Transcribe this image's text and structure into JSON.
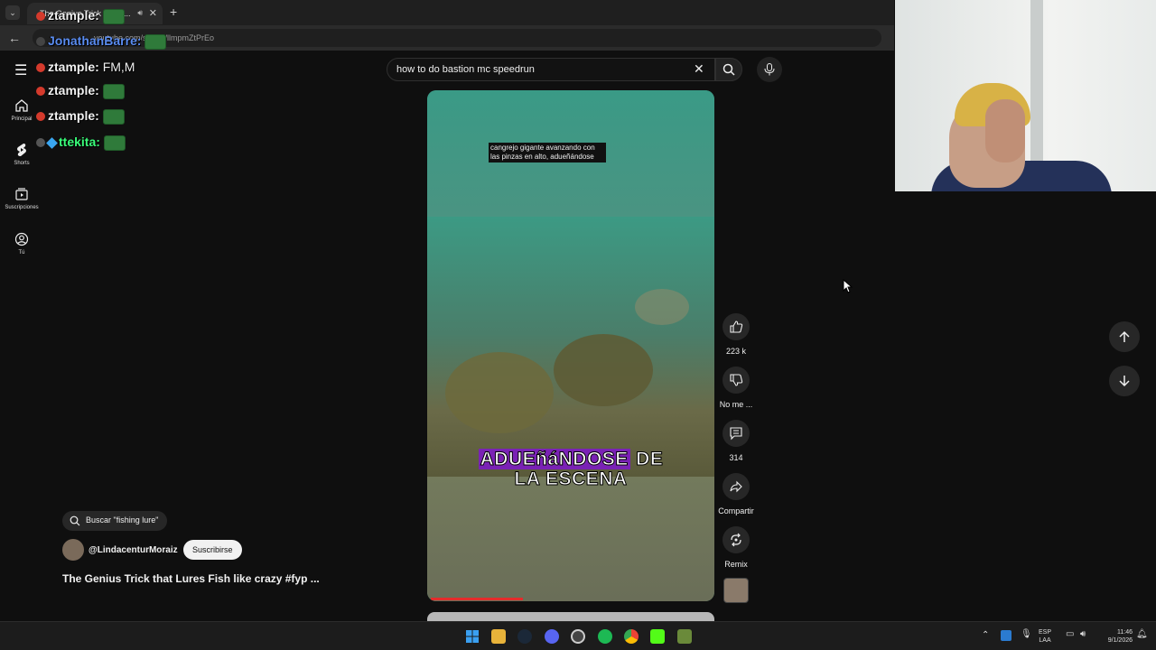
{
  "browser": {
    "tab_title": "The Genius Trick that L...",
    "url": "youtube.com/shorts/llmpmZtPrEo"
  },
  "search": {
    "query": "how to do bastion mc speedrun"
  },
  "sidebar": {
    "items": [
      {
        "label": "Principal",
        "icon": "home-icon"
      },
      {
        "label": "Shorts",
        "icon": "shorts-icon"
      },
      {
        "label": "Suscripciones",
        "icon": "subscriptions-icon"
      },
      {
        "label": "Tú",
        "icon": "account-icon"
      }
    ]
  },
  "chat": {
    "messages": [
      {
        "user": "ztample:",
        "color": "#f0f0f0",
        "text": ""
      },
      {
        "user": "JonathanBarre:",
        "color": "#5a8cf0",
        "text": ""
      },
      {
        "user": "ztample:",
        "color": "#f0f0f0",
        "text": "FM,M"
      },
      {
        "user": "ztample:",
        "color": "#f0f0f0",
        "text": ""
      },
      {
        "user": "ztample:",
        "color": "#f0f0f0",
        "text": ""
      },
      {
        "user": "ttekita:",
        "color": "#3aff7a",
        "text": ""
      }
    ]
  },
  "video": {
    "small_caption": "cangrejo gigante avanzando con las pinzas en alto, adueñándose",
    "big_caption_line1_highlight": "ADUEñáNDOSE",
    "big_caption_line1_rest": "DE",
    "big_caption_line2": "LA ESCENA",
    "progress_fraction": 0.33
  },
  "actions": {
    "like_count": "223 k",
    "dislike_label": "No me ...",
    "comment_count": "314",
    "share_label": "Compartir",
    "remix_label": "Remix"
  },
  "info": {
    "search_pill": "Buscar \"fishing lure\"",
    "channel": "@LindacenturMoraiz",
    "subscribe_label": "Suscribirse",
    "title": "The Genius Trick that Lures Fish like crazy #fyp ..."
  },
  "taskbar": {
    "lang_top": "ESP",
    "lang_bottom": "LAA",
    "time": "11:46",
    "date": "9/1/2026"
  },
  "colors": {
    "accent_red": "#e52b2b",
    "caption_highlight": "#7a22b5",
    "background": "#0f0f0f"
  }
}
